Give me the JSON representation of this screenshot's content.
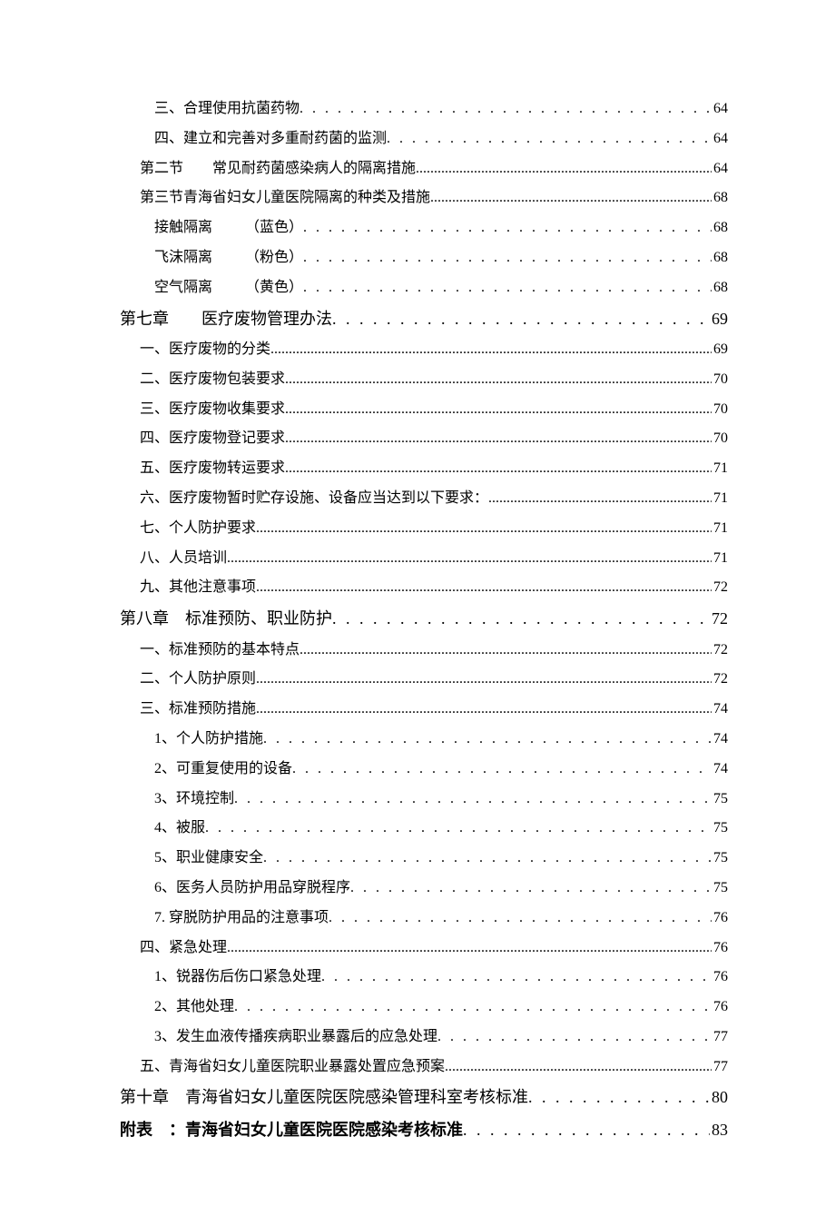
{
  "toc": [
    {
      "indent": "indent-1",
      "label": "三、合理使用抗菌药物",
      "page": "64",
      "fill": "dots-wide",
      "cls": ""
    },
    {
      "indent": "indent-1",
      "label": "四、建立和完善对多重耐药菌的监测",
      "page": "64",
      "fill": "dots-wide",
      "cls": ""
    },
    {
      "indent": "indent-2",
      "label": "第二节　　常见耐药菌感染病人的隔离措施",
      "page": "64",
      "fill": "dots-tight",
      "cls": ""
    },
    {
      "indent": "indent-2",
      "label": "第三节青海省妇女儿童医院隔离的种类及措施",
      "page": "68",
      "fill": "dots-tight",
      "cls": ""
    },
    {
      "indent": "indent-1",
      "label_a": "接触隔离",
      "label_b": "（蓝色）",
      "page": "68",
      "fill": "dots-wide",
      "cls": "",
      "split": true
    },
    {
      "indent": "indent-1",
      "label_a": "飞沫隔离",
      "label_b": "（粉色）",
      "page": "68",
      "fill": "dots-wide",
      "cls": "",
      "split": true
    },
    {
      "indent": "indent-1",
      "label_a": "空气隔离",
      "label_b": "（黄色）",
      "page": "68",
      "fill": "dots-wide",
      "cls": "",
      "split": true
    },
    {
      "indent": "indent-0",
      "label": "第七章　　医疗废物管理办法",
      "page": "69",
      "fill": "dots-wide",
      "cls": "chapter"
    },
    {
      "indent": "indent-2",
      "label": "一、医疗废物的分类",
      "page": "69",
      "fill": "dots-tight",
      "cls": ""
    },
    {
      "indent": "indent-2",
      "label": "二、医疗废物包装要求",
      "page": "70",
      "fill": "dots-tight",
      "cls": ""
    },
    {
      "indent": "indent-2",
      "label": "三、医疗废物收集要求",
      "page": "70",
      "fill": "dots-tight",
      "cls": ""
    },
    {
      "indent": "indent-2",
      "label": "四、医疗废物登记要求",
      "page": "70",
      "fill": "dots-tight",
      "cls": ""
    },
    {
      "indent": "indent-2",
      "label": "五、医疗废物转运要求",
      "page": "71",
      "fill": "dots-tight",
      "cls": ""
    },
    {
      "indent": "indent-2",
      "label": "六、医疗废物暂时贮存设施、设备应当达到以下要求：",
      "page": "71",
      "fill": "dots-tight",
      "cls": ""
    },
    {
      "indent": "indent-2",
      "label": "七、个人防护要求",
      "page": "71",
      "fill": "dots-tight",
      "cls": ""
    },
    {
      "indent": "indent-2",
      "label": "八、人员培训",
      "page": "71",
      "fill": "dots-tight",
      "cls": ""
    },
    {
      "indent": "indent-2",
      "label": "九、其他注意事项",
      "page": "72",
      "fill": "dots-tight",
      "cls": ""
    },
    {
      "indent": "indent-0",
      "label": "第八章　标准预防、职业防护",
      "page": "72",
      "fill": "dots-wide",
      "cls": "chapter"
    },
    {
      "indent": "indent-2",
      "label": "一、标准预防的基本特点",
      "page": "72",
      "fill": "dots-tight",
      "cls": ""
    },
    {
      "indent": "indent-2",
      "label": "二、个人防护原则",
      "page": "72",
      "fill": "dots-tight",
      "cls": ""
    },
    {
      "indent": "indent-2",
      "label": "三、标准预防措施",
      "page": "74",
      "fill": "dots-tight",
      "cls": ""
    },
    {
      "indent": "indent-1",
      "label": "1、个人防护措施",
      "page": "74",
      "fill": "dots-wide",
      "cls": ""
    },
    {
      "indent": "indent-1",
      "label": "2、可重复使用的设备",
      "page": "74",
      "fill": "dots-wide",
      "cls": ""
    },
    {
      "indent": "indent-1",
      "label": "3、环境控制",
      "page": "75",
      "fill": "dots-wide",
      "cls": ""
    },
    {
      "indent": "indent-1",
      "label": "4、被服",
      "page": "75",
      "fill": "dots-wide",
      "cls": ""
    },
    {
      "indent": "indent-1",
      "label": "5、职业健康安全",
      "page": "75",
      "fill": "dots-wide",
      "cls": ""
    },
    {
      "indent": "indent-1",
      "label": "6、医务人员防护用品穿脱程序",
      "page": "75",
      "fill": "dots-wide",
      "cls": ""
    },
    {
      "indent": "indent-1",
      "label": "7. 穿脱防护用品的注意事项",
      "page": "76",
      "fill": "dots-wide",
      "cls": ""
    },
    {
      "indent": "indent-2",
      "label": "四、紧急处理",
      "page": "76",
      "fill": "dots-tight",
      "cls": ""
    },
    {
      "indent": "indent-1",
      "label": "1、锐器伤后伤口紧急处理",
      "page": "76",
      "fill": "dots-wide",
      "cls": ""
    },
    {
      "indent": "indent-1",
      "label": "2、其他处理",
      "page": "76",
      "fill": "dots-wide",
      "cls": ""
    },
    {
      "indent": "indent-1",
      "label": "3、发生血液传播疾病职业暴露后的应急处理",
      "page": "77",
      "fill": "dots-wide",
      "cls": ""
    },
    {
      "indent": "indent-2",
      "label": "五、青海省妇女儿童医院职业暴露处置应急预案",
      "page": "77",
      "fill": "dots-tight",
      "cls": ""
    },
    {
      "indent": "indent-0",
      "label": "第十章　青海省妇女儿童医院医院感染管理科室考核标准",
      "page": "80",
      "fill": "dots-wide",
      "cls": "chapter"
    },
    {
      "indent": "indent-0",
      "label": "附表　：青海省妇女儿童医院医院感染考核标准",
      "page": "83",
      "fill": "dots-wide",
      "cls": "chapter bold"
    }
  ]
}
